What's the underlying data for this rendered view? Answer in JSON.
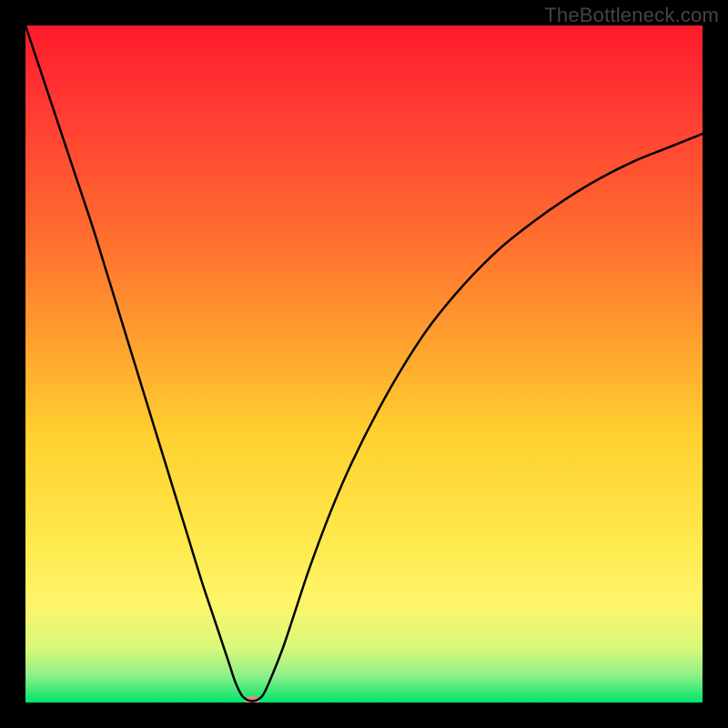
{
  "watermark": "TheBottleneck.com",
  "chart_data": {
    "type": "line",
    "title": "",
    "xlabel": "",
    "ylabel": "",
    "xlim": [
      0,
      100
    ],
    "ylim": [
      0,
      100
    ],
    "grid": false,
    "background": {
      "type": "vertical-gradient",
      "stops": [
        {
          "pos": 0.0,
          "color": "#ff1a2b"
        },
        {
          "pos": 0.12,
          "color": "#ff3a33"
        },
        {
          "pos": 0.3,
          "color": "#ff6a2f"
        },
        {
          "pos": 0.45,
          "color": "#ff9a2f"
        },
        {
          "pos": 0.6,
          "color": "#ffcf2f"
        },
        {
          "pos": 0.75,
          "color": "#ffe74a"
        },
        {
          "pos": 0.85,
          "color": "#fff56a"
        },
        {
          "pos": 0.92,
          "color": "#d8f87a"
        },
        {
          "pos": 0.96,
          "color": "#8ef08a"
        },
        {
          "pos": 1.0,
          "color": "#00e46a"
        }
      ]
    },
    "series": [
      {
        "name": "bottleneck-curve",
        "color": "#000000",
        "stroke_width": 2.5,
        "x": [
          0,
          2,
          4,
          6,
          8,
          10,
          12,
          14,
          16,
          18,
          20,
          22,
          24,
          26,
          28,
          30,
          31,
          32,
          33,
          34,
          35,
          36,
          38,
          40,
          42,
          45,
          48,
          52,
          56,
          60,
          65,
          70,
          75,
          80,
          85,
          90,
          95,
          100
        ],
        "y": [
          100,
          94,
          88,
          82,
          76,
          70,
          63.5,
          57,
          50.5,
          44,
          37.5,
          31,
          24.5,
          18,
          12,
          6,
          3,
          1,
          0.3,
          0.3,
          1,
          3,
          8,
          14,
          20,
          28,
          35,
          43,
          50,
          56,
          62,
          67,
          71,
          74.5,
          77.5,
          80,
          82,
          84
        ]
      }
    ],
    "marker": {
      "name": "min-point",
      "x": 33.5,
      "y": 0.3,
      "color": "#e58a8a",
      "rx": 8,
      "ry": 5
    }
  }
}
